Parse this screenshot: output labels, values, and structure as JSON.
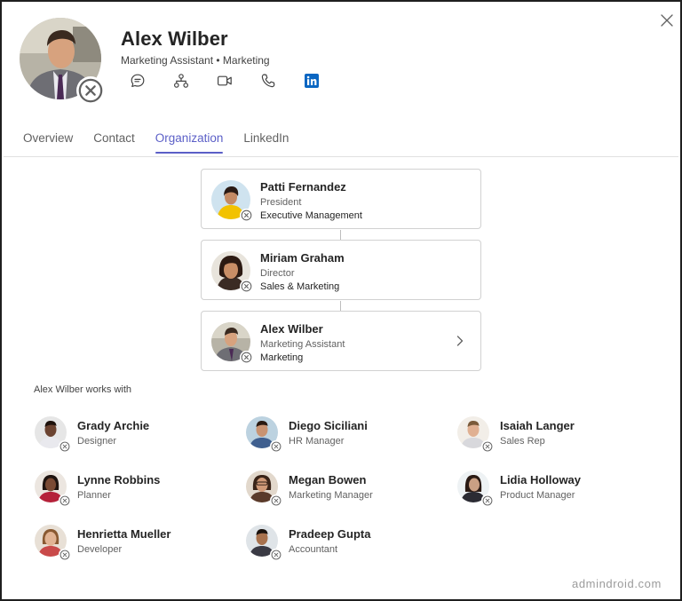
{
  "profile": {
    "name": "Alex Wilber",
    "subtitle": "Marketing Assistant • Marketing",
    "actions": [
      {
        "icon": "chat-icon",
        "label": "Chat"
      },
      {
        "icon": "org-chart-icon",
        "label": "Organization"
      },
      {
        "icon": "video-call-icon",
        "label": "Video call"
      },
      {
        "icon": "phone-call-icon",
        "label": "Audio call"
      },
      {
        "icon": "linkedin-icon",
        "label": "LinkedIn"
      }
    ]
  },
  "tabs": [
    {
      "label": "Overview",
      "active": false
    },
    {
      "label": "Contact",
      "active": false
    },
    {
      "label": "Organization",
      "active": true
    },
    {
      "label": "LinkedIn",
      "active": false
    }
  ],
  "org_chain": [
    {
      "name": "Patti Fernandez",
      "title": "President",
      "department": "Executive Management"
    },
    {
      "name": "Miriam Graham",
      "title": "Director",
      "department": "Sales & Marketing"
    },
    {
      "name": "Alex Wilber",
      "title": "Marketing Assistant",
      "department": "Marketing"
    }
  ],
  "works_with": {
    "label": "Alex Wilber works with",
    "people": [
      {
        "name": "Grady Archie",
        "role": "Designer"
      },
      {
        "name": "Diego Siciliani",
        "role": "HR Manager"
      },
      {
        "name": "Isaiah Langer",
        "role": "Sales Rep"
      },
      {
        "name": "Lynne Robbins",
        "role": "Planner"
      },
      {
        "name": "Megan Bowen",
        "role": "Marketing Manager"
      },
      {
        "name": "Lidia Holloway",
        "role": "Product Manager"
      },
      {
        "name": "Henrietta Mueller",
        "role": "Developer"
      },
      {
        "name": "Pradeep Gupta",
        "role": "Accountant"
      }
    ]
  },
  "watermark": "admindroid.com",
  "colors": {
    "accent": "#5b5fc7",
    "linkedin": "#0a66c2",
    "border": "#d1d1d1",
    "muted_text": "#616161"
  }
}
